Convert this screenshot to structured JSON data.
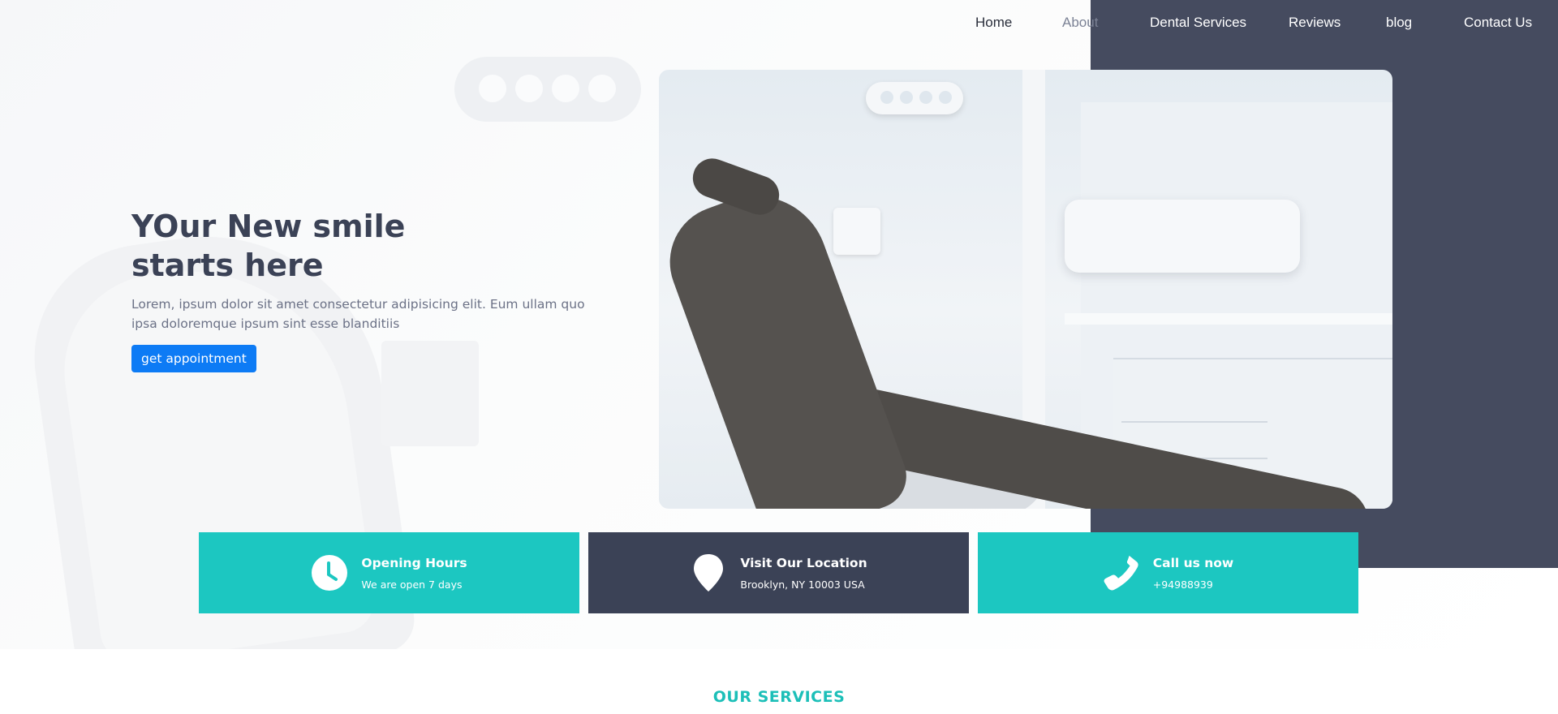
{
  "nav": {
    "items": [
      {
        "label": "Home"
      },
      {
        "label": "About"
      },
      {
        "label": "Dental Services"
      },
      {
        "label": "Reviews"
      },
      {
        "label": "blog"
      },
      {
        "label": "Contact Us"
      }
    ]
  },
  "hero": {
    "title": "YOur New smile starts here",
    "description": "Lorem, ipsum dolor sit amet consectetur adipisicing elit. Eum ullam quo ipsa doloremque ipsum sint esse blanditiis",
    "button_label": "get appointment",
    "image_alt": "dental chair in clinic"
  },
  "info_cards": [
    {
      "title": "Opening Hours",
      "subtitle": "We are open 7 days",
      "icon": "clock-icon",
      "color": "#1cc7c1"
    },
    {
      "title": "Visit Our Location",
      "subtitle": "Brooklyn, NY 10003 USA",
      "icon": "map-pin-icon",
      "color": "#3b4256"
    },
    {
      "title": "Call us now",
      "subtitle": "+94988939",
      "icon": "phone-icon",
      "color": "#1cc7c1"
    }
  ],
  "services": {
    "heading": "OUR SERVICES"
  },
  "colors": {
    "accent": "#1cc7c1",
    "dark": "#3b4256",
    "primary_button": "#0d7bf5",
    "dark_block": "#454b5f"
  }
}
